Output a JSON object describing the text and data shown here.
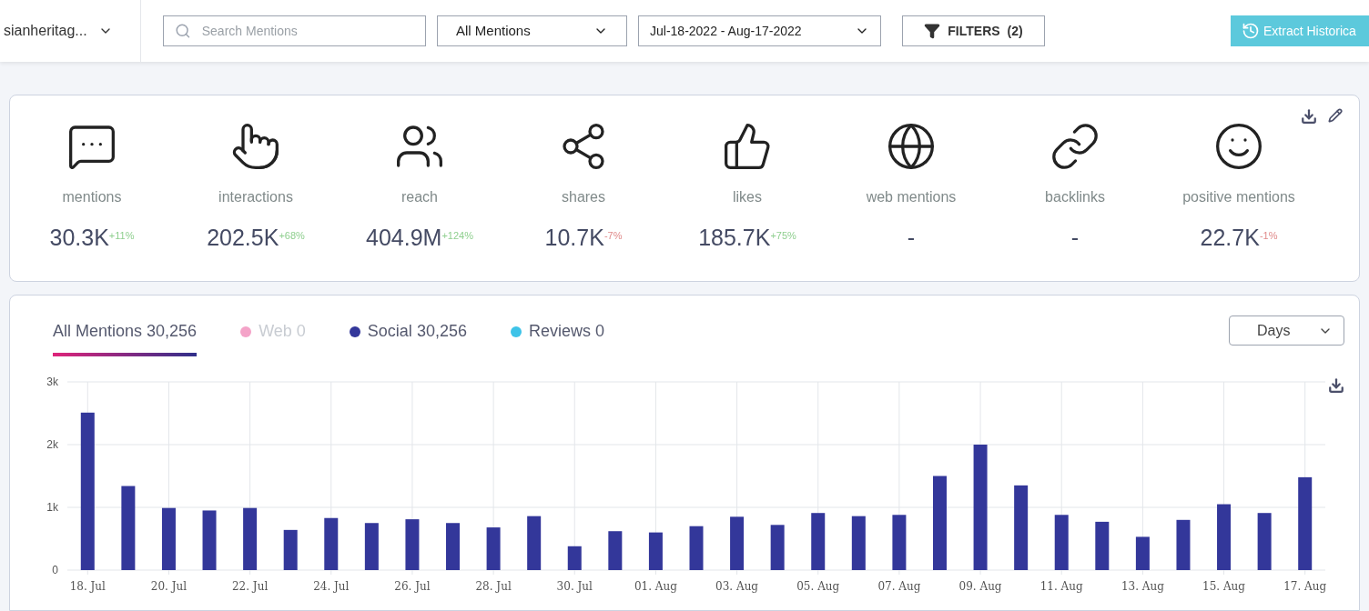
{
  "topbar": {
    "project": "sianheritag...",
    "search": {
      "placeholder": "Search Mentions"
    },
    "mention_filter": "All Mentions",
    "date_range": "Jul-18-2022 - Aug-17-2022",
    "filters": {
      "label": "FILTERS",
      "count": "(2)"
    },
    "extract_button": "Extract Historica"
  },
  "stats": [
    {
      "kind": "mentions",
      "label": "mentions",
      "value": "30.3K",
      "change": "+11%",
      "color": "#8fcf8f"
    },
    {
      "kind": "interactions",
      "label": "interactions",
      "value": "202.5K",
      "change": "+68%",
      "color": "#8fcf8f"
    },
    {
      "kind": "reach",
      "label": "reach",
      "value": "404.9M",
      "change": "+124%",
      "color": "#8fcf8f"
    },
    {
      "kind": "shares",
      "label": "shares",
      "value": "10.7K",
      "change": "-7%",
      "color": "#e08a8a"
    },
    {
      "kind": "likes",
      "label": "likes",
      "value": "185.7K",
      "change": "+75%",
      "color": "#8fcf8f"
    },
    {
      "kind": "web",
      "label": "web mentions",
      "value": "-"
    },
    {
      "kind": "backlinks",
      "label": "backlinks",
      "value": "-"
    },
    {
      "kind": "positive",
      "label": "positive mentions",
      "value": "22.7K",
      "change": "-1%",
      "color": "#e08a8a"
    }
  ],
  "chart_tabs": [
    {
      "label": "All Mentions",
      "count": "30,256",
      "selected": true,
      "disabled": false
    },
    {
      "label": "Web",
      "count": "0",
      "color": "#f4a3c8",
      "selected": false,
      "disabled": true
    },
    {
      "label": "Social",
      "count": "30,256",
      "color": "#33379a",
      "selected": false,
      "disabled": false
    },
    {
      "label": "Reviews",
      "count": "0",
      "color": "#3ec3e8",
      "selected": false,
      "disabled": false
    }
  ],
  "interval_select": "Days",
  "chart_data": {
    "type": "bar",
    "grid": true,
    "ylim": [
      0,
      3000
    ],
    "yticks": [
      {
        "value": 0,
        "label": "0"
      },
      {
        "value": 1000,
        "label": "1k"
      },
      {
        "value": 2000,
        "label": "2k"
      },
      {
        "value": 3000,
        "label": "3k"
      }
    ],
    "categories": [
      "18. Jul",
      null,
      "20. Jul",
      null,
      "22. Jul",
      null,
      "24. Jul",
      null,
      "26. Jul",
      null,
      "28. Jul",
      null,
      "30. Jul",
      null,
      "01. Aug",
      null,
      "03. Aug",
      null,
      "05. Aug",
      null,
      "07. Aug",
      null,
      "09. Aug",
      null,
      "11. Aug",
      null,
      "13. Aug",
      null,
      "15. Aug",
      null,
      "17. Aug"
    ],
    "values": [
      2510,
      1340,
      990,
      950,
      990,
      640,
      830,
      750,
      810,
      750,
      680,
      860,
      380,
      620,
      600,
      700,
      850,
      720,
      910,
      860,
      880,
      1500,
      2000,
      1350,
      880,
      770,
      530,
      800,
      1050,
      910,
      1480
    ]
  }
}
